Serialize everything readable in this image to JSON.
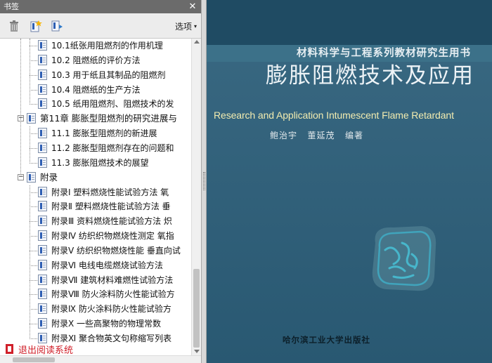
{
  "pane": {
    "title": "书签",
    "options_label": "选项",
    "options_arrow": "▾",
    "close_glyph": "✕",
    "toolbar_icons": [
      "delete-bookmark-icon",
      "new-bookmark-icon",
      "expand-bookmark-icon"
    ]
  },
  "tree": {
    "rows": [
      {
        "kind": "leaf",
        "label": "10.1纸张用阻燃剂的作用机理"
      },
      {
        "kind": "leaf",
        "label": "10.2 阻燃纸的评价方法"
      },
      {
        "kind": "leaf",
        "label": "10.3 用于纸且其制品的阻燃剂"
      },
      {
        "kind": "leaf",
        "label": "10.4 阻燃纸的生产方法"
      },
      {
        "kind": "leaf",
        "label": "10.5 纸用阻燃剂、阻燃技术的发"
      },
      {
        "kind": "chapter",
        "label": "第11章 膨胀型阻燃剂的研究进展与"
      },
      {
        "kind": "leaf",
        "label": "11.1 膨胀型阻燃剂的新进展"
      },
      {
        "kind": "leaf",
        "label": "11.2 膨胀型阻燃剂存在的问题和"
      },
      {
        "kind": "leaf",
        "label": "11.3 膨胀阻燃技术的展望"
      },
      {
        "kind": "chapter",
        "label": "附录"
      },
      {
        "kind": "leaf",
        "label": "附录Ⅰ 塑料燃烧性能试验方法 氧"
      },
      {
        "kind": "leaf",
        "label": "附录Ⅱ 塑料燃烧性能试验方法 垂"
      },
      {
        "kind": "leaf",
        "label": "附录Ⅲ 资料燃烧性能试验方法 炽"
      },
      {
        "kind": "leaf",
        "label": "附录Ⅳ 纺织织物燃烧性测定 氧指"
      },
      {
        "kind": "leaf",
        "label": "附录Ⅴ 纺织织物燃烧性能 垂直向试"
      },
      {
        "kind": "leaf",
        "label": "附录Ⅵ 电线电缆燃烧试验方法"
      },
      {
        "kind": "leaf",
        "label": "附录Ⅶ 建筑材料难燃性试验方法"
      },
      {
        "kind": "leaf",
        "label": "附录Ⅷ 防火涂料防火性能试验方"
      },
      {
        "kind": "leaf",
        "label": "附录Ⅸ 防火涂料防火性能试验方"
      },
      {
        "kind": "leaf",
        "label": "附录Ⅹ 一些高聚物的物理常数"
      },
      {
        "kind": "leaf",
        "label": "附录Ⅺ 聚合物英文句称缩写列表"
      }
    ],
    "exit_label": "退出阅读系统"
  },
  "cover": {
    "series_title": "材料科学与工程系列教材研究生用书",
    "main_title": "膨胀阻燃技术及应用",
    "english_title": "Research and Application Intumescent Flame Retardant",
    "author1": "鲍治宇",
    "author2": "董延茂",
    "author_role": "编著",
    "publisher": "哈尔滨工业大学出版社",
    "seal_text": "签名章"
  },
  "colors": {
    "cover_bg": "#2b5d78",
    "english_title": "#f2ecb0",
    "exit_text": "#d0202a",
    "header_bg": "#6b6b6b"
  }
}
